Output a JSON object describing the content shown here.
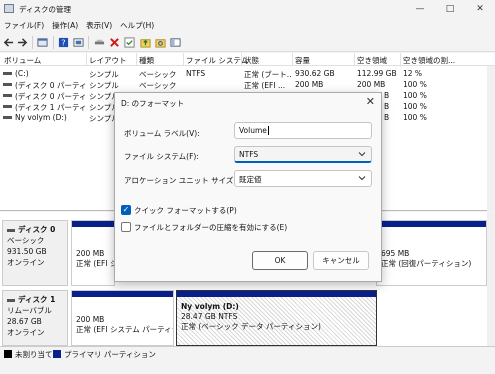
{
  "window": {
    "title": "ディスクの管理"
  },
  "menu": [
    "ファイル(F)",
    "操作(A)",
    "表示(V)",
    "ヘルプ(H)"
  ],
  "icons": {
    "back": "arrow-left-icon",
    "forward": "arrow-right-icon",
    "properties": "properties-icon",
    "help": "help-icon",
    "console": "console-icon",
    "connect": "connect-icon",
    "delete": "delete-icon",
    "check": "check-icon",
    "up": "up-arrow-icon",
    "search": "search-icon",
    "view": "view-icon"
  },
  "colors": {
    "primary_partition": "#0b1f8c",
    "unallocated": "#000000",
    "accent": "#005fb8"
  },
  "volumes": {
    "headers": [
      "ボリューム",
      "レイアウト",
      "種類",
      "ファイル システム",
      "状態",
      "容量",
      "空き領域",
      "空き領域の割..."
    ],
    "rows": [
      {
        "name": "(C:)",
        "layout": "シンプル",
        "type": "ベーシック",
        "fs": "NTFS",
        "status": "正常 (ブート...",
        "capacity": "930.62 GB",
        "free": "112.99 GB",
        "pct": "12 %"
      },
      {
        "name": "(ディスク 0 パーティション...",
        "layout": "シンプル",
        "type": "ベーシック",
        "fs": "",
        "status": "正常 (EFI ...",
        "capacity": "200 MB",
        "free": "200 MB",
        "pct": "100 %"
      },
      {
        "name": "(ディスク 0 パーティショ...",
        "layout": "シンプル",
        "type": "",
        "fs": "",
        "status": "",
        "capacity": "",
        "free": "B",
        "pct": "100 %"
      },
      {
        "name": "(ディスク 1 パーティショ...",
        "layout": "シンプル",
        "type": "",
        "fs": "",
        "status": "",
        "capacity": "",
        "free": "B",
        "pct": "100 %"
      },
      {
        "name": "Ny volym (D:)",
        "layout": "シンプル",
        "type": "",
        "fs": "",
        "status": "",
        "capacity": "",
        "free": "B",
        "pct": "100 %"
      }
    ]
  },
  "disks": [
    {
      "name": "ディスク 0",
      "type": "ベーシック",
      "size": "931.50 GB",
      "state": "オンライン",
      "partitions": [
        {
          "line1": "200 MB",
          "line2": "正常 (EFI シ"
        },
        {
          "line1": "695 MB",
          "line2": "正常 (回復パーティション)"
        }
      ]
    },
    {
      "name": "ディスク 1",
      "type": "リムーバブル",
      "size": "28.67 GB",
      "state": "オンライン",
      "partitions": [
        {
          "line1": "200 MB",
          "line2": "正常 (EFI システム パーティション"
        },
        {
          "title": "Ny volym  (D:)",
          "line1": "28.47 GB NTFS",
          "line2": "正常 (ベーシック データ パーティション)"
        }
      ]
    }
  ],
  "legend": {
    "unallocated": "未割り当て",
    "primary": "プライマリ パーティション"
  },
  "dialog": {
    "title": "D: のフォーマット",
    "volume_label": {
      "label": "ボリューム ラベル(V):",
      "value": "Volume"
    },
    "file_system": {
      "label": "ファイル システム(F):",
      "value": "NTFS"
    },
    "allocation": {
      "label": "アロケーション ユニット サイズ(A):",
      "value": "既定値"
    },
    "quick_format": {
      "label": "クイック フォーマットする(P)",
      "checked": true
    },
    "compression": {
      "label": "ファイルとフォルダーの圧縮を有効にする(E)",
      "checked": false
    },
    "ok": "OK",
    "cancel": "キャンセル"
  }
}
